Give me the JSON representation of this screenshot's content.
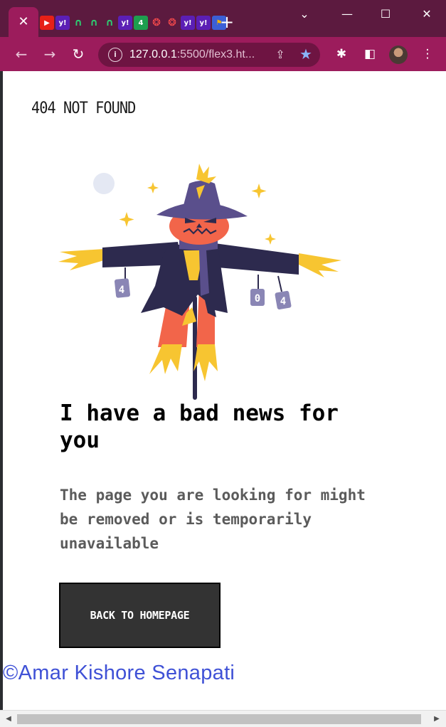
{
  "browser": {
    "active_tab_close": "✕",
    "pinned_tabs": [
      {
        "icon": "youtube-icon",
        "glyph": "▶"
      },
      {
        "icon": "yahoo-icon",
        "glyph": "y!"
      },
      {
        "icon": "green-arc-icon",
        "glyph": "∩"
      },
      {
        "icon": "green-arc-icon",
        "glyph": "∩"
      },
      {
        "icon": "green-arc-icon",
        "glyph": "∩"
      },
      {
        "icon": "yahoo-icon",
        "glyph": "y!"
      },
      {
        "icon": "channel4-icon",
        "glyph": "4"
      },
      {
        "icon": "red-ring-icon",
        "glyph": "❂"
      },
      {
        "icon": "red-ring-icon",
        "glyph": "❂"
      },
      {
        "icon": "yahoo-icon",
        "glyph": "y!"
      },
      {
        "icon": "yahoo-icon",
        "glyph": "y!"
      },
      {
        "icon": "flag-icon",
        "glyph": "⚑"
      }
    ],
    "new_tab": "+",
    "window_controls": {
      "minimize": "—",
      "maximize": "☐",
      "close": "✕",
      "tab_search": "⌄"
    },
    "nav": {
      "back": "←",
      "forward": "→",
      "reload": "↻"
    },
    "address": {
      "info": "i",
      "host": "127.0.0.1",
      "rest": ":5500/flex3.ht...",
      "share": "⇪",
      "star": "★"
    },
    "tools": {
      "extensions": "✱",
      "side_panel": "◧",
      "menu": "⋮"
    },
    "scrollbar": {
      "left": "◀",
      "right": "▶"
    }
  },
  "page": {
    "logo": "404 NOT FOUND",
    "headline": "I have a bad news for you",
    "subtext": "The page you are looking for might be removed or is temporarily unavailable",
    "cta": "BACK TO HOMEPAGE",
    "can_labels": [
      "4",
      "0",
      "4"
    ],
    "credit": "©Amar Kishore Senapati"
  },
  "colors": {
    "tab_strip": "#5c1a3f",
    "toolbar": "#9c1c5c",
    "credit": "#3f51d6",
    "cta_bg": "#333333",
    "scarecrow_face": "#f2654a",
    "scarecrow_hat": "#5a4f8c",
    "scarecrow_coat": "#2d2a4e",
    "straw": "#f7c531"
  }
}
